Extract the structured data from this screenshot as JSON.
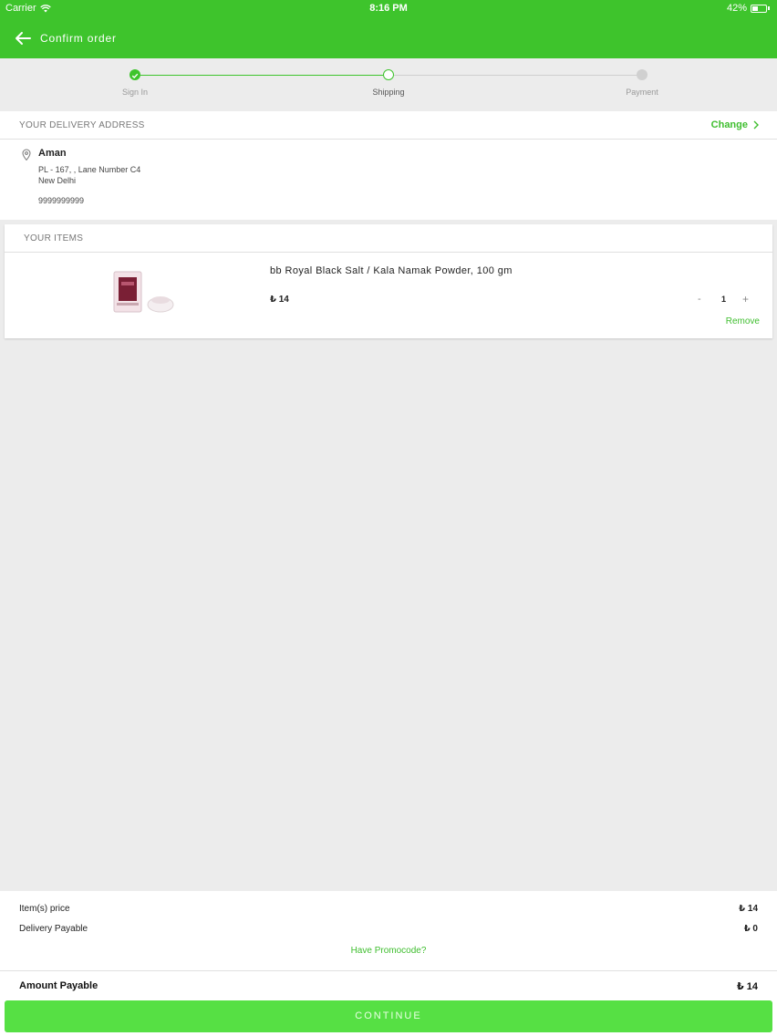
{
  "status_bar": {
    "carrier": "Carrier",
    "time": "8:16 PM",
    "battery": "42%",
    "battery_level": 0.42
  },
  "navbar": {
    "title": "Confirm order",
    "back_icon": "arrow-left-icon"
  },
  "stepper": {
    "steps": [
      {
        "label": "Sign In",
        "state": "done"
      },
      {
        "label": "Shipping",
        "state": "current"
      },
      {
        "label": "Payment",
        "state": "pending"
      }
    ],
    "accent": "#3ec42c"
  },
  "address": {
    "section_title": "YOUR DELIVERY ADDRESS",
    "change_label": "Change",
    "name": "Aman",
    "line1": "PL - 167, , Lane Number C4",
    "line2": "New Delhi",
    "phone": "9999999999"
  },
  "items": {
    "section_title": "YOUR ITEMS",
    "list": [
      {
        "name": "bb Royal Black Salt / Kala Namak Powder, 100 gm",
        "price": "₺ 14",
        "qty": "1",
        "minus": "-",
        "plus": "+",
        "remove_label": "Remove"
      }
    ]
  },
  "summary": {
    "items_price_label": "Item(s) price",
    "items_price": "₺ 14",
    "delivery_label": "Delivery Payable",
    "delivery": "₺ 0",
    "promo_label": "Have Promocode?",
    "amount_label": "Amount Payable",
    "amount": "₺ 14"
  },
  "continue_label": "CONTINUE",
  "colors": {
    "brand_green": "#3ec42c",
    "link_green": "#3fbe2f",
    "button_green": "#56e044",
    "background": "#ececec"
  }
}
